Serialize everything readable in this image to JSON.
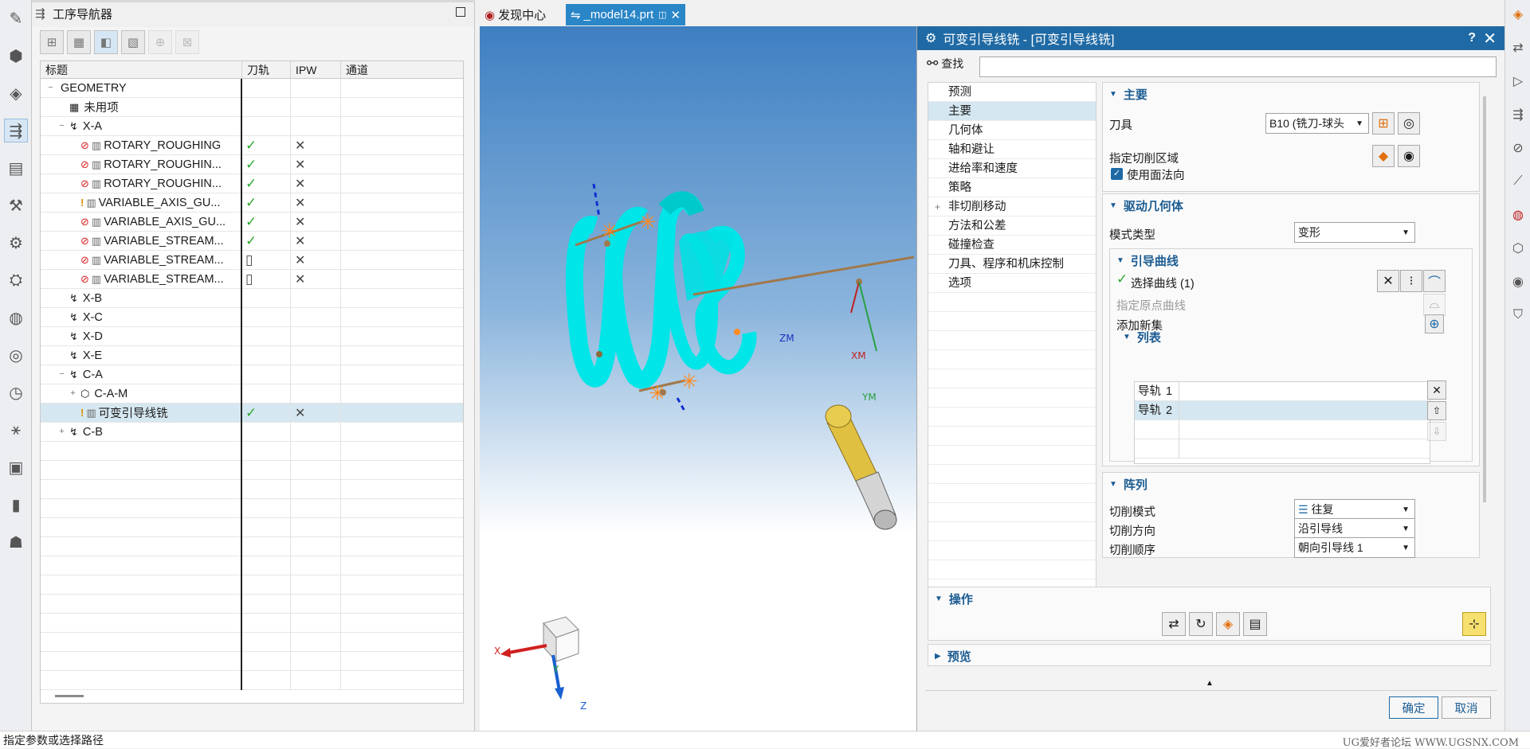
{
  "navigator": {
    "title": "工序导航器",
    "columns": [
      "标题",
      "刀轨",
      "IPW",
      "通道"
    ],
    "rows": [
      {
        "indent": 0,
        "toggle": "−",
        "icons": "",
        "warn": "",
        "label": "GEOMETRY",
        "path": "",
        "ipw": "",
        "sel": false
      },
      {
        "indent": 1,
        "toggle": "",
        "icons": "▦",
        "warn": "",
        "label": "未用项",
        "path": "",
        "ipw": "",
        "sel": false
      },
      {
        "indent": 1,
        "toggle": "−",
        "icons": "↯",
        "warn": "",
        "label": "X-A",
        "path": "",
        "ipw": "",
        "sel": false
      },
      {
        "indent": 2,
        "toggle": "",
        "icons": "⊘",
        "warn": "",
        "label": "ROTARY_ROUGHING",
        "path": "✓",
        "ipw": "✕",
        "sel": false
      },
      {
        "indent": 2,
        "toggle": "",
        "icons": "⊘",
        "warn": "",
        "label": "ROTARY_ROUGHIN...",
        "path": "✓",
        "ipw": "✕",
        "sel": false
      },
      {
        "indent": 2,
        "toggle": "",
        "icons": "⊘",
        "warn": "",
        "label": "ROTARY_ROUGHIN...",
        "path": "✓",
        "ipw": "✕",
        "sel": false
      },
      {
        "indent": 2,
        "toggle": "",
        "icons": "",
        "warn": "!",
        "label": "VARIABLE_AXIS_GU...",
        "path": "✓",
        "ipw": "✕",
        "sel": false
      },
      {
        "indent": 2,
        "toggle": "",
        "icons": "⊘",
        "warn": "",
        "label": "VARIABLE_AXIS_GU...",
        "path": "✓",
        "ipw": "✕",
        "sel": false
      },
      {
        "indent": 2,
        "toggle": "",
        "icons": "⊘",
        "warn": "",
        "label": "VARIABLE_STREAM...",
        "path": "✓",
        "ipw": "✕",
        "sel": false
      },
      {
        "indent": 2,
        "toggle": "",
        "icons": "⊘",
        "warn": "",
        "label": "VARIABLE_STREAM...",
        "path": "▯",
        "ipw": "✕",
        "sel": false
      },
      {
        "indent": 2,
        "toggle": "",
        "icons": "⊘",
        "warn": "",
        "label": "VARIABLE_STREAM...",
        "path": "▯",
        "ipw": "✕",
        "sel": false
      },
      {
        "indent": 1,
        "toggle": "",
        "icons": "↯",
        "warn": "",
        "label": "X-B",
        "path": "",
        "ipw": "",
        "sel": false
      },
      {
        "indent": 1,
        "toggle": "",
        "icons": "↯",
        "warn": "",
        "label": "X-C",
        "path": "",
        "ipw": "",
        "sel": false
      },
      {
        "indent": 1,
        "toggle": "",
        "icons": "↯",
        "warn": "",
        "label": "X-D",
        "path": "",
        "ipw": "",
        "sel": false
      },
      {
        "indent": 1,
        "toggle": "",
        "icons": "↯",
        "warn": "",
        "label": "X-E",
        "path": "",
        "ipw": "",
        "sel": false
      },
      {
        "indent": 1,
        "toggle": "−",
        "icons": "↯",
        "warn": "",
        "label": "C-A",
        "path": "",
        "ipw": "",
        "sel": false
      },
      {
        "indent": 2,
        "toggle": "+",
        "icons": "⬡",
        "warn": "",
        "label": "C-A-M",
        "path": "",
        "ipw": "",
        "sel": false
      },
      {
        "indent": 2,
        "toggle": "",
        "icons": "",
        "warn": "!",
        "label": "可变引导线铣",
        "path": "✓",
        "ipw": "✕",
        "sel": true
      },
      {
        "indent": 1,
        "toggle": "+",
        "icons": "↯",
        "warn": "",
        "label": "C-B",
        "path": "",
        "ipw": "",
        "sel": false
      }
    ]
  },
  "tabs": [
    {
      "label": "发现中心",
      "active": false
    },
    {
      "label": "_model14.prt",
      "active": true
    }
  ],
  "viewport": {
    "labels": {
      "zm": "ZM",
      "xm": "XM",
      "ym": "YM",
      "x": "X",
      "y": "Y",
      "z": "Z"
    }
  },
  "dialog": {
    "title": "可变引导线铣 - [可变引导线铣]",
    "help": "?",
    "close": "✕",
    "find_label": "查找",
    "find_value": "",
    "nav_items": [
      {
        "label": "预测",
        "sel": false,
        "plus": false
      },
      {
        "label": "主要",
        "sel": true,
        "plus": false
      },
      {
        "label": "几何体",
        "sel": false,
        "plus": false
      },
      {
        "label": "轴和避让",
        "sel": false,
        "plus": false
      },
      {
        "label": "进给率和速度",
        "sel": false,
        "plus": false
      },
      {
        "label": "策略",
        "sel": false,
        "plus": false
      },
      {
        "label": "非切削移动",
        "sel": false,
        "plus": true
      },
      {
        "label": "方法和公差",
        "sel": false,
        "plus": false
      },
      {
        "label": "碰撞检查",
        "sel": false,
        "plus": false
      },
      {
        "label": "刀具、程序和机床控制",
        "sel": false,
        "plus": false
      },
      {
        "label": "选项",
        "sel": false,
        "plus": false
      }
    ],
    "main": {
      "header": "主要",
      "tool_label": "刀具",
      "tool_value": "B10 (铣刀-球头",
      "cut_area_label": "指定切削区域",
      "use_face_normal_label": "使用面法向",
      "use_face_normal_checked": true
    },
    "drive": {
      "header": "驱动几何体",
      "mode_label": "模式类型",
      "mode_value": "变形",
      "guide_header": "引导曲线",
      "select_curve_label": "选择曲线 (1)",
      "origin_curve_label": "指定原点曲线",
      "add_set_label": "添加新集",
      "list_header": "列表",
      "list_rows": [
        {
          "name": "导轨",
          "num": "1",
          "sel": false
        },
        {
          "name": "导轨",
          "num": "2",
          "sel": true
        }
      ]
    },
    "pattern": {
      "header": "阵列",
      "cut_mode_label": "切削模式",
      "cut_mode_value": "往复",
      "cut_dir_label": "切削方向",
      "cut_dir_value": "沿引导线",
      "cut_order_label": "切削顺序",
      "cut_order_value": "朝向引导线 1"
    },
    "actions_header": "操作",
    "preview_header": "预览",
    "ok_label": "确定",
    "cancel_label": "取消"
  },
  "status": {
    "prompt": "指定参数或选择路径",
    "watermark": "UG爱好者论坛 WWW.UGSNX.COM"
  },
  "colors": {
    "accent": "#1f6aa5",
    "surface": "#00e5e8",
    "tool": "#e0c040"
  }
}
